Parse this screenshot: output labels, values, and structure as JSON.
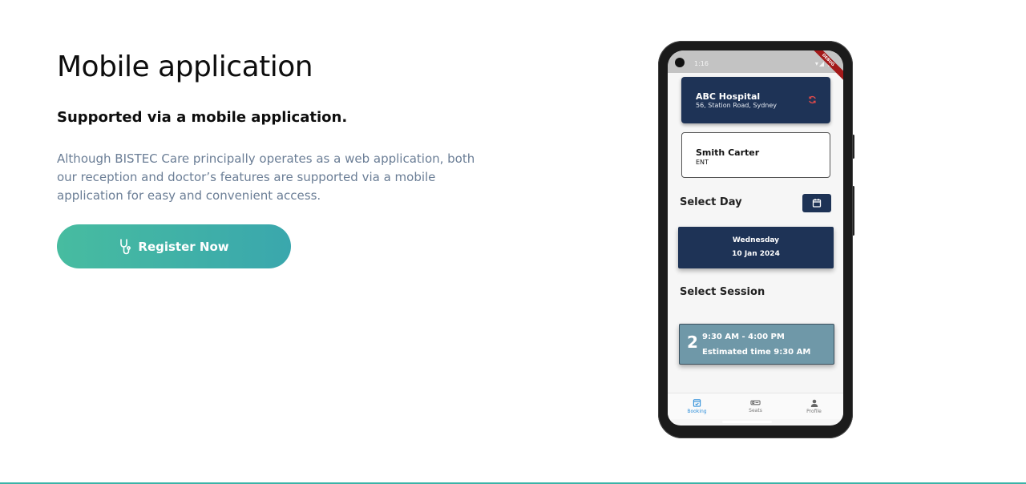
{
  "hero": {
    "title": "Mobile application",
    "subtitle": "Supported via a mobile application.",
    "description": "Although BISTEC Care principally operates as a web application, both our reception and doctor’s features are supported via a mobile application for easy and convenient access.",
    "register_label": "Register Now",
    "register_icon": "stethoscope-icon"
  },
  "phone": {
    "status_time": "1:16",
    "status_icons": "▾◢ ▮",
    "debug_banner": "DEBUG",
    "hospital": {
      "name": "ABC Hospital",
      "address": "56, Station Road, Sydney",
      "refresh_icon": "refresh-icon"
    },
    "doctor": {
      "name": "Smith Carter",
      "specialty": "ENT"
    },
    "select_day_label": "Select Day",
    "day": {
      "weekday": "Wednesday",
      "date": "10 Jan 2024"
    },
    "select_session_label": "Select Session",
    "session": {
      "number": "2",
      "time_range": "9:30 AM - 4:00 PM",
      "estimated": "Estimated time 9:30 AM"
    },
    "nav": [
      {
        "label": "Booking",
        "icon": "calendar-icon",
        "active": true
      },
      {
        "label": "Seats",
        "icon": "seat-icon",
        "active": false
      },
      {
        "label": "Profile",
        "icon": "person-icon",
        "active": false
      }
    ]
  },
  "colors": {
    "navy": "#1e3356",
    "teal_start": "#47bca0",
    "teal_end": "#3aa7ad",
    "session": "#6f98a8",
    "muted_text": "#6b7e96",
    "nav_active": "#2f8fd9"
  }
}
